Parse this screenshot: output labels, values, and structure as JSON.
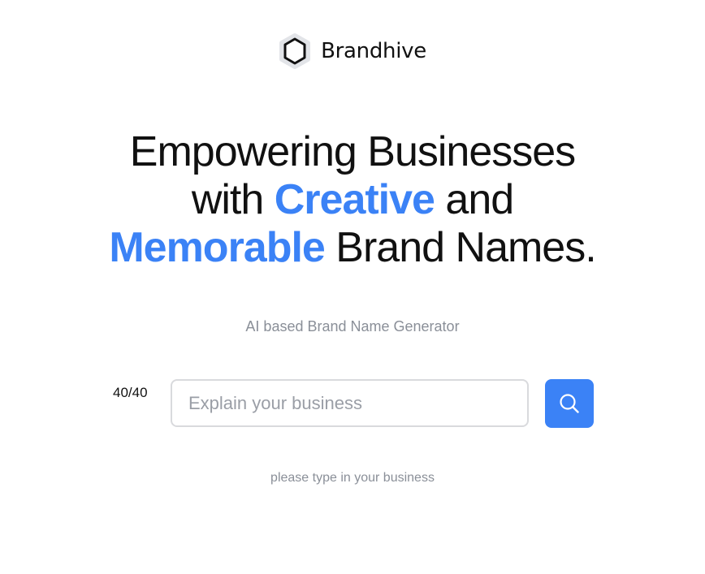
{
  "brand": {
    "logo_icon": "hexagon-icon",
    "name": "Brandhive"
  },
  "hero": {
    "line1": "Empowering Businesses",
    "line2_pre": "with ",
    "line2_accent": "Creative",
    "line2_post": " and",
    "line3_accent": "Memorable",
    "line3_post": " Brand Names."
  },
  "subtitle": "AI based Brand Name Generator",
  "search": {
    "counter": "40/40",
    "placeholder": "Explain your business",
    "value": "",
    "button_icon": "search-icon"
  },
  "hint": "please type in your business",
  "colors": {
    "accent": "#3b82f6",
    "muted_text": "#8a8f98",
    "input_border": "#d9dadd"
  }
}
